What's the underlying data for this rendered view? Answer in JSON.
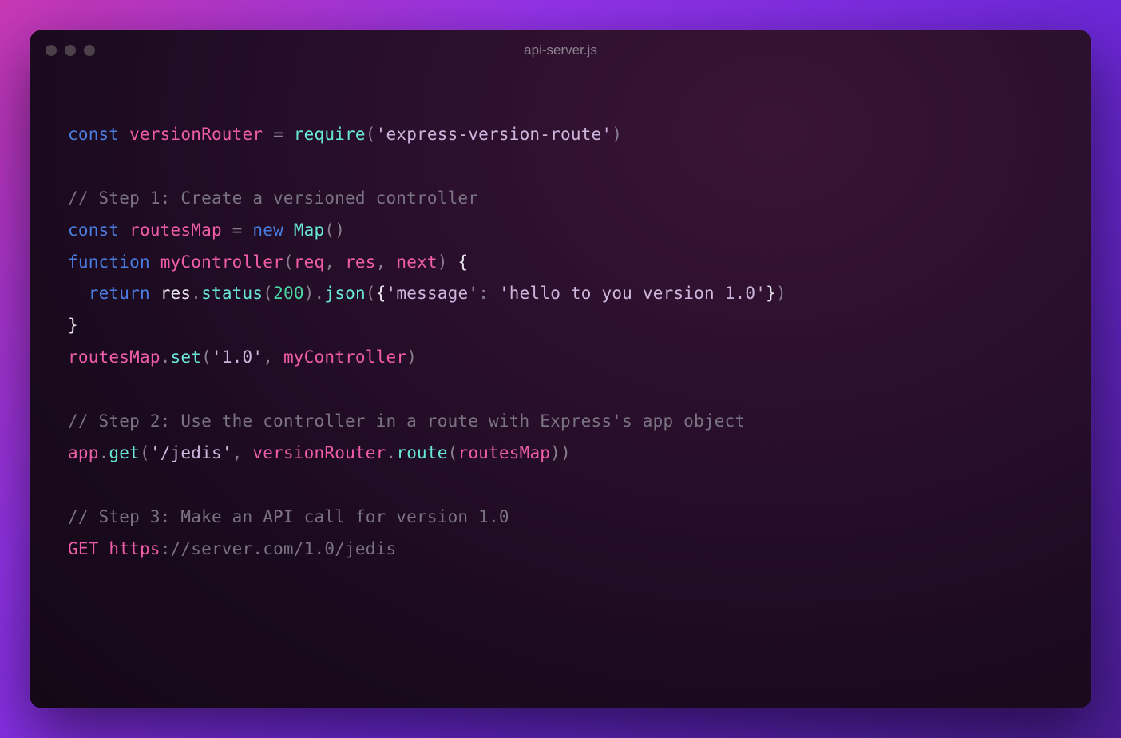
{
  "window": {
    "filename": "api-server.js"
  },
  "code": {
    "l1": {
      "kw_const": "const",
      "var_router": "versionRouter",
      "op_eq": "=",
      "fn_require": "require",
      "paren_o": "(",
      "str_pkg": "'express-version-route'",
      "paren_c": ")"
    },
    "l2_blank": "",
    "l3": {
      "comment": "// Step 1: Create a versioned controller"
    },
    "l4": {
      "kw_const": "const",
      "var_map": "routesMap",
      "op_eq": "=",
      "kw_new": "new",
      "cls_map": "Map",
      "parens": "()"
    },
    "l5": {
      "kw_func": "function",
      "fn_name": "myController",
      "paren_o": "(",
      "p_req": "req",
      "c1": ",",
      "p_res": "res",
      "c2": ",",
      "p_next": "next",
      "paren_c": ")",
      "brace_o": "{"
    },
    "l6": {
      "indent": "  ",
      "kw_return": "return",
      "obj_res": "res",
      "dot1": ".",
      "fn_status": "status",
      "po1": "(",
      "num_200": "200",
      "pc1": ")",
      "dot2": ".",
      "fn_json": "json",
      "po2": "(",
      "brace_o": "{",
      "str_key": "'message'",
      "colon": ":",
      "str_val": "'hello to you version 1.0'",
      "brace_c": "}",
      "pc2": ")"
    },
    "l7": {
      "brace_c": "}"
    },
    "l8": {
      "obj": "routesMap",
      "dot": ".",
      "fn_set": "set",
      "po": "(",
      "str_v": "'1.0'",
      "comma": ",",
      "arg_ctrl": "myController",
      "pc": ")"
    },
    "l9_blank": "",
    "l10": {
      "comment": "// Step 2: Use the controller in a route with Express's app object"
    },
    "l11": {
      "obj_app": "app",
      "dot1": ".",
      "fn_get": "get",
      "po1": "(",
      "str_path": "'/jedis'",
      "comma": ",",
      "obj_vr": "versionRouter",
      "dot2": ".",
      "fn_route": "route",
      "po2": "(",
      "arg_map": "routesMap",
      "pc2": ")",
      "pc1": ")"
    },
    "l12_blank": "",
    "l13": {
      "comment": "// Step 3: Make an API call for version 1.0"
    },
    "l14": {
      "verb": "GET",
      "scheme": "https",
      "rest": "://server.com/1.0/jedis"
    }
  }
}
